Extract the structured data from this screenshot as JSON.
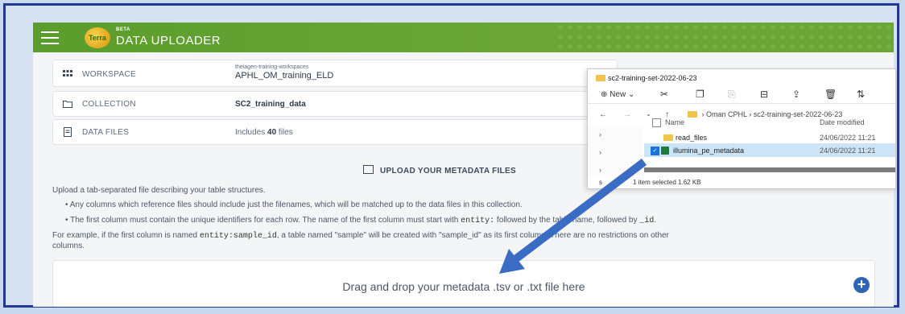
{
  "app": {
    "beta": "BETA",
    "title": "DATA UPLOADER",
    "logo": "Terra"
  },
  "cards": {
    "workspace": {
      "label": "WORKSPACE",
      "namespace": "theiagen-training-workspaces",
      "name": "APHL_OM_training_ELD"
    },
    "collection": {
      "label": "COLLECTION",
      "value": "SC2_training_data"
    },
    "data_files": {
      "label": "DATA FILES",
      "value_prefix": "Includes ",
      "count": "40",
      "value_suffix": " files"
    }
  },
  "upload": {
    "heading": "UPLOAD YOUR METADATA FILES",
    "intro": "Upload a tab-separated file describing your table structures.",
    "bullet1": "• Any columns which reference files should include just the filenames, which will be matched up to the data files in this collection.",
    "bullet2_a": "• The first column must contain the unique identifiers for each row. The name of the first column must start with ",
    "bullet2_code": "entity:",
    "bullet2_b": " followed by the table name, followed by ",
    "bullet2_code2": "_id",
    "bullet2_c": ".",
    "example_a": "For example, if the first column is named ",
    "example_code": "entity:sample_id",
    "example_b": ", a table named \"sample\" will be created with \"sample_id\" as its first column. There are no restrictions on other",
    "example_c": "columns.",
    "drop_text": "Drag and drop your metadata .tsv or .txt file here"
  },
  "explorer": {
    "title": "sc2-training-set-2022-06-23",
    "new_label": "New",
    "breadcrumb": [
      "Oman CPHL",
      "sc2-training-set-2022-06-23"
    ],
    "col_name": "Name",
    "col_date": "Date modified",
    "files": [
      {
        "name": "read_files",
        "date": "24/06/2022 11:21"
      },
      {
        "name": "illumina_pe_metadata",
        "date": "24/06/2022 11:21"
      }
    ],
    "status_count": "s",
    "status_selected": "1 item selected  1.62 KB"
  },
  "colors": {
    "accent": "#2f63b6",
    "header_green": "#5a9d2c",
    "arrow": "#3b6cc4"
  }
}
